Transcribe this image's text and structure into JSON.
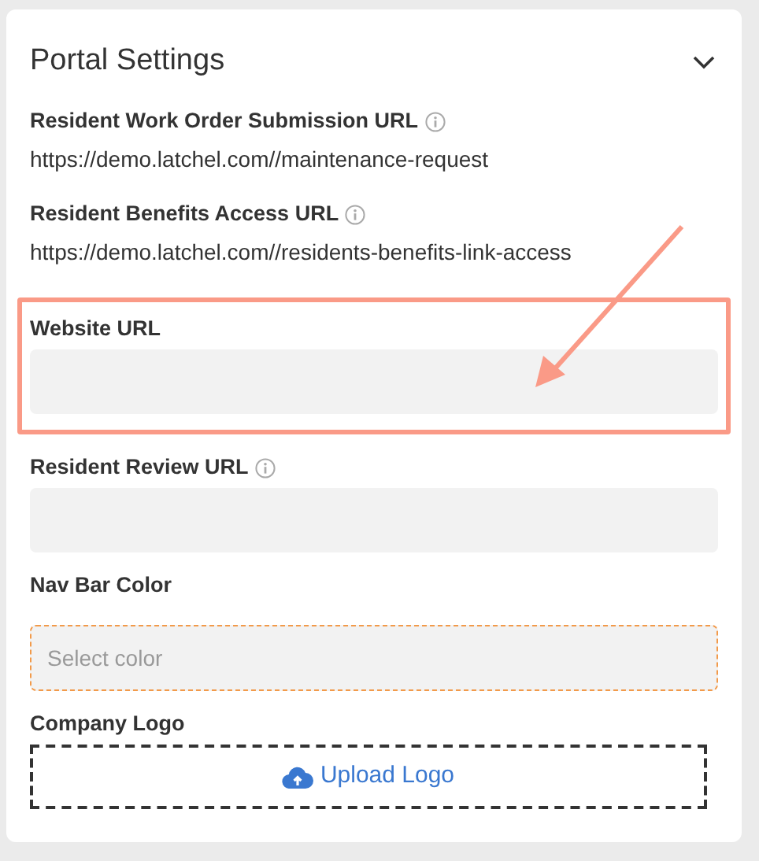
{
  "panel": {
    "title": "Portal Settings",
    "expanded": true
  },
  "links": [
    {
      "label": "Resident Work Order Submission URL",
      "info": true,
      "url": "https://demo.latchel.com//maintenance-request"
    },
    {
      "label": "Resident Benefits Access URL",
      "info": true,
      "url": "https://demo.latchel.com//residents-benefits-link-access"
    }
  ],
  "fields": [
    {
      "kind": "text",
      "label": "Website URL",
      "info": false,
      "highlighted": true
    },
    {
      "kind": "text",
      "label": "Resident Review URL",
      "info": true,
      "highlighted": false
    },
    {
      "kind": "color",
      "label": "Nav Bar Color",
      "info": false,
      "highlighted": false,
      "placeholder": "Select color"
    },
    {
      "kind": "upload",
      "label": "Company Logo",
      "info": false,
      "highlighted": false,
      "button": "Upload Logo"
    }
  ]
}
